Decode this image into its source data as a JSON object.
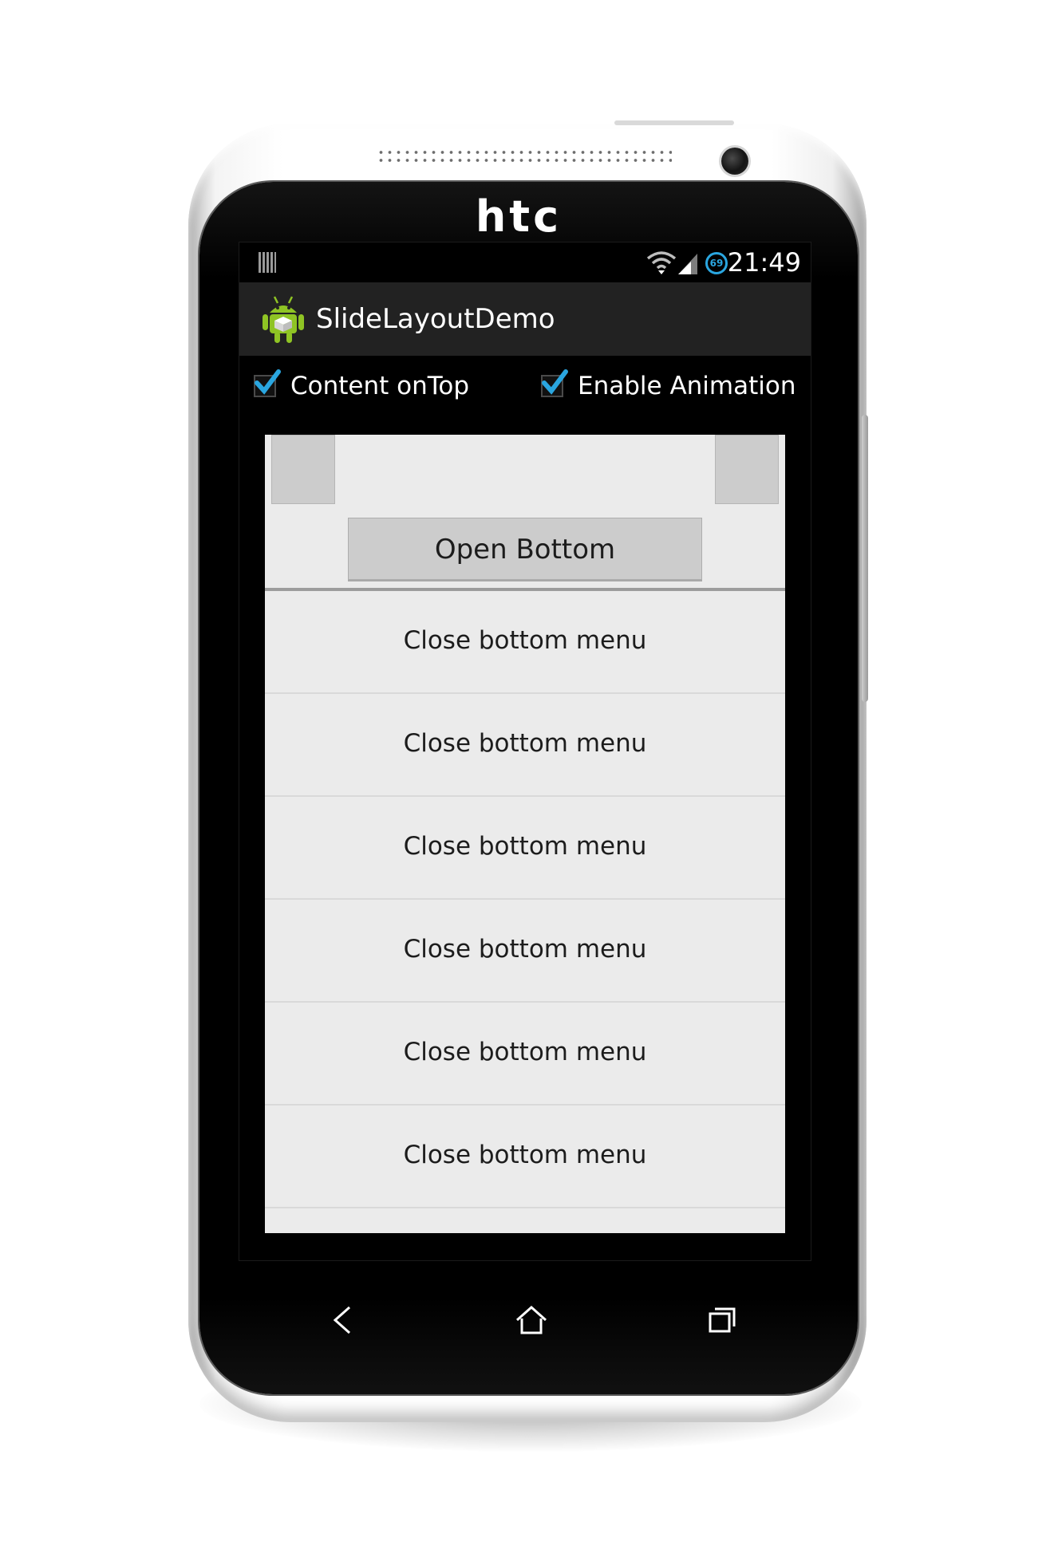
{
  "device": {
    "brand": "htc"
  },
  "status_bar": {
    "time": "21:49",
    "battery_level": "69",
    "icons": [
      "notification-icon",
      "wifi-icon",
      "signal-icon",
      "battery-icon"
    ]
  },
  "action_bar": {
    "title": "SlideLayoutDemo",
    "icon": "android-app-icon"
  },
  "options": {
    "content_on_top": {
      "label": "Content onTop",
      "checked": true
    },
    "enable_animation": {
      "label": "Enable Animation",
      "checked": true
    }
  },
  "content": {
    "open_bottom_label": "Open Bottom",
    "menu_items": [
      "Close bottom menu",
      "Close bottom menu",
      "Close bottom menu",
      "Close bottom menu",
      "Close bottom menu",
      "Close bottom menu"
    ]
  },
  "navigation": {
    "buttons": [
      "back-icon",
      "home-icon",
      "recent-apps-icon"
    ]
  },
  "colors": {
    "accent": "#2aa6e0",
    "action_bar": "#222222",
    "content_bg": "#ebebeb",
    "button_bg": "#cccccc"
  }
}
